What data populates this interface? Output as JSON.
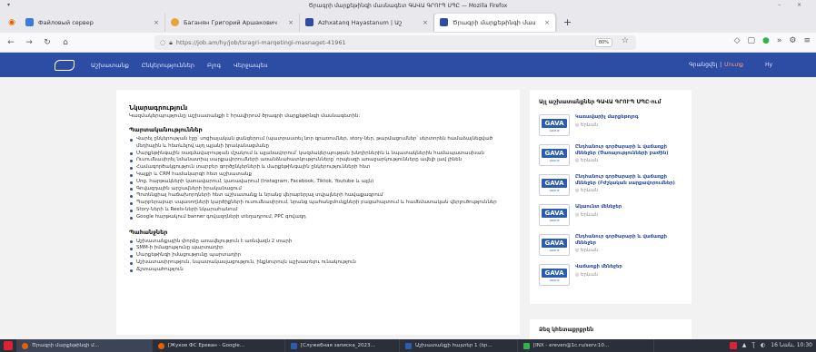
{
  "window": {
    "title": "Ծրագրի մարքեթինգի մասնագետ ԳԱՎԱ ԳՐՈՒՊ ՍՊԸ — Mozilla Firefox",
    "controls": "– ×"
  },
  "tabs": [
    {
      "label": "Файловый сервер",
      "color": "#3a7bd5"
    },
    {
      "label": "Баганян Григорий Аршакович",
      "color": "#e8a43c"
    },
    {
      "label": "Azhxatanq Hayastanum | Աշ",
      "color": "#2d4ca3"
    },
    {
      "label": "Ծրագրի մարքեթինգի մաս",
      "color": "#2d4ca3",
      "active": true
    }
  ],
  "nav": {
    "url": "https://job.am/hy/job/tsragri-marqetingi-masnaget-41961",
    "zoom": "80%"
  },
  "site": {
    "nav_items": [
      "Աշխատանք",
      "Ընկերություններ",
      "Բլոգ",
      "Վերջապես"
    ],
    "login": "Գրանցվել",
    "separator": "|",
    "account": "Մուտք",
    "lang": "Hy"
  },
  "main": {
    "title": "Նկարագրություն",
    "lead": "Կազմակերպությունը աշխատանքի է հրավիրում ծրագրի մարքեթինգի մասնագետին:",
    "resp_title": "Պարտականություններ",
    "responsibilities": [
      "Վարել ընկերության էջը՝ սոցիալական ցանցերում (պատրաստել նոր գրառումներ, story-ներ, թարմացումներ՝ սերտորեն համաձայնեցված մեդիային և հետևելով այդ պլանի իրականացմանը",
      "Մարքեթինգային ռազմավարության մշակում և պլանավորում՝ կազմակերպության խնդիրներին և նպատակներին համապատասխան",
      "Ուսումնասիրել նմանատիպ սարքավորումների առանձնահատկությունները՝ որպեսզի առաջարկությունները ավելի լավ լինեն",
      "Համագործակցություն տարբեր գործընկերների և մարքեթինգային ընկերությունների հետ",
      "Կայքի և CRM համակարգի հետ աշխատանք",
      "Սոց. հարթակների կառավարում, կառավարում (Instagram, Facebook, Tiktok, Youtube և այլն)",
      "Գովազդային արշավների իրականացում",
      "Պոտենցիալ հաճախորդների հետ աշխատանք և նրանց վերաբերյալ տվյալների հավաքագրում",
      "Պարբերաբար սպառողների կարծիքների ուսումնասիրում, նրանց պահանջմունքների բացահայտում և համեմատական վերլուծություններ",
      "Story-ների և Reels-ների նկարահանում",
      "Google հարթակում banner գովազդների տեղադրում, PPC գովազդ"
    ],
    "req_title": "Պահանջներ",
    "requirements": [
      "Աշխատանքային փորձը առավելություն է առնվազն 2 տարի",
      "SMM-ի իմացությունը պարտադիր",
      "Մարքեթինգի իմացությունը պարտադիր",
      "Աշխատասիրություն, նպատակասլացություն, ինքնուրույն աշխատելու ունակություն",
      "Ճշտապահություն"
    ]
  },
  "side": {
    "title": "Այլ աշխատանքներ ԳԱՎԱ ԳՐՈՒՊ ՍՊԸ-ում",
    "logo_main": "GAVA",
    "logo_sub": "GROUP",
    "jobs": [
      {
        "title": "Կառավարիչ մարքեթոլոգ",
        "location": "Երևան"
      },
      {
        "title": "Ընդհանուր գործարարի և վաճառքի մենեջեր (Ծառայությունների բաժին)",
        "location": "Երևան"
      },
      {
        "title": "Ընդհանուր գործարարի և վաճառքի մենեջեր (Բժշկական սարքավորումներ)",
        "location": "Երևան"
      },
      {
        "title": "Ակաունտ մենեջեր",
        "location": "Երևան"
      },
      {
        "title": "Ընդհանուր գործարարի և վաճառքի մենեջեր",
        "location": "Երևան"
      },
      {
        "title": "Վաճառքի մենեջեր",
        "location": "Երևան"
      }
    ],
    "second_title": "Ձեզ կհետաքրքրեն"
  },
  "taskbar": {
    "items": [
      {
        "label": "Ծրագրի մարքեթինգի մ…",
        "color": "#e66000",
        "active": true
      },
      {
        "label": "[Жуков ФС Ереван - Google…",
        "color": "#e66000"
      },
      {
        "label": "[Служебная записка_2023…",
        "color": "#2a5db0"
      },
      {
        "label": "Աշխատանքի հայտեր 1 (եր…",
        "color": "#2a5db0"
      },
      {
        "label": "[INX - ereven@1c.ru/serv:10…",
        "color": "#2fb34a"
      }
    ],
    "clock": "16 Նաև, 10:30"
  }
}
